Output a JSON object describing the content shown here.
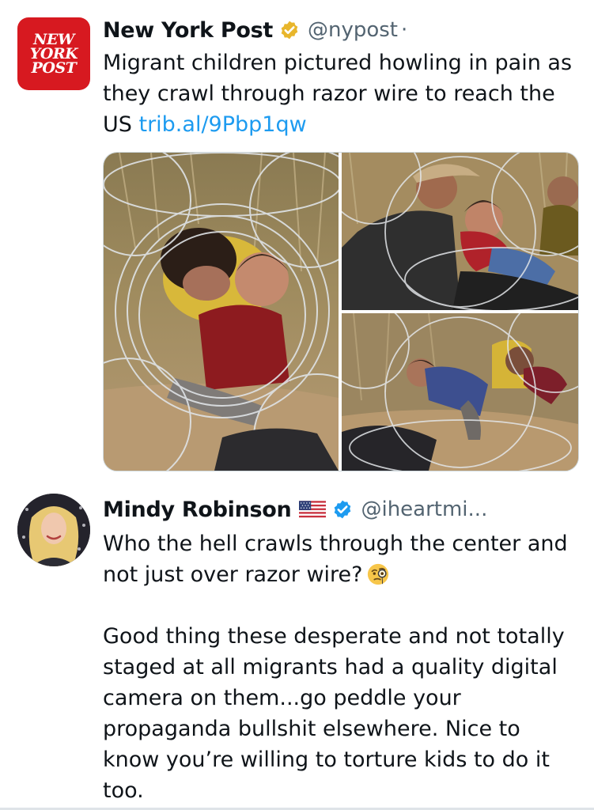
{
  "tweets": [
    {
      "display_name": "New York Post",
      "handle": "@nypost",
      "separator": "·",
      "verified": "gold-verified-badge",
      "avatar": {
        "type": "logo",
        "logo_lines": [
          "NEW",
          "YORK",
          "POST"
        ],
        "color": "#d71920"
      },
      "text_prefix": "Migrant children pictured howling in pain as they crawl through razor wire to reach the US ",
      "link": "trib.al/9Pbp1qw",
      "media": [
        {
          "icon": "photo-child-crying-under-razor-wire"
        },
        {
          "icon": "photo-man-carrying-child-through-wire"
        },
        {
          "icon": "photo-child-crawling-through-wire"
        }
      ]
    },
    {
      "display_name": "Mindy Robinson",
      "handle": "@iheartmi...",
      "verified": "blue-verified-badge",
      "flag": "us-flag-icon",
      "avatar": {
        "type": "photo"
      },
      "paragraph_1": "Who the hell crawls through the center and not just over razor wire?",
      "emoji": "face-with-monocle-emoji",
      "paragraph_2": "Good thing these desperate and not totally staged at all migrants had a quality digital camera on them...go peddle your propaganda bullshit elsewhere. Nice to know you’re willing to torture kids to do it too."
    }
  ],
  "colors": {
    "text": "#0f1419",
    "secondary": "#536471",
    "link": "#1d9bf0",
    "gold_badge": "#e8b62c",
    "blue_badge": "#1d9bf0"
  }
}
